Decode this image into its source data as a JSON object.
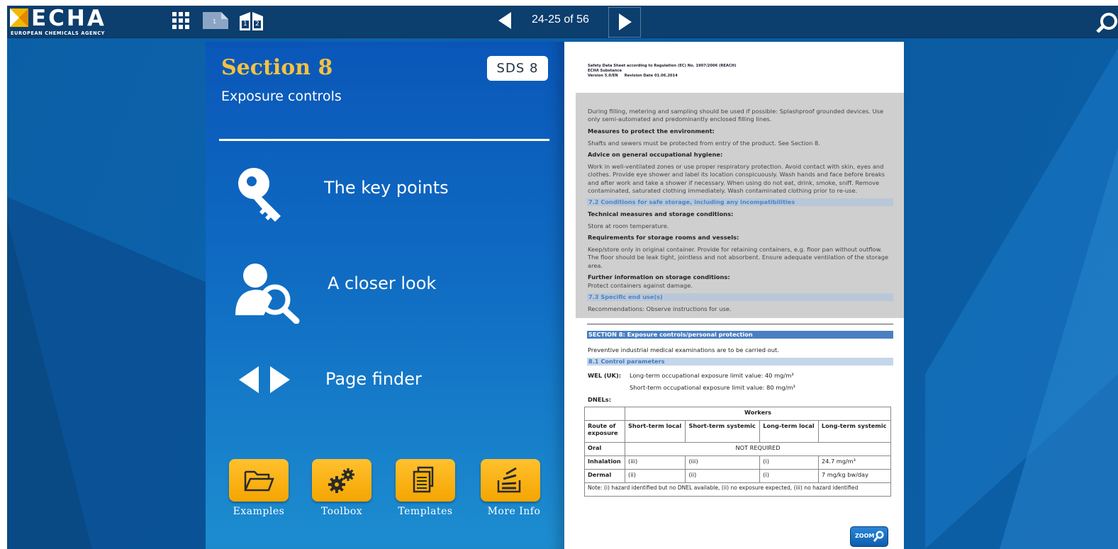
{
  "toolbar": {
    "logo_text": "ECHA",
    "logo_subtitle": "EUROPEAN CHEMICALS AGENCY",
    "page_indicator": "24-25 of 56",
    "single_page_num": "1",
    "double_page_nums": [
      "1",
      "2"
    ]
  },
  "left_page": {
    "section_title": "Section 8",
    "section_subtitle": "Exposure controls",
    "badge": "SDS 8",
    "menu": [
      {
        "label": "The key points",
        "icon": "key-icon"
      },
      {
        "label": "A closer look",
        "icon": "person-magnifier-icon"
      },
      {
        "label": "Page finder",
        "icon": "left-right-arrows-icon"
      }
    ],
    "tiles": [
      {
        "label": "Examples",
        "icon": "open-folder-icon"
      },
      {
        "label": "Toolbox",
        "icon": "gears-icon"
      },
      {
        "label": "Templates",
        "icon": "documents-icon"
      },
      {
        "label": "More Info",
        "icon": "stack-info-icon"
      }
    ]
  },
  "right_page": {
    "header": [
      "Safety Data Sheet according to Regulation (EC) No. 1907/2006 (REACH)",
      "ECHA Substance",
      "Version 5.0/EN     Revision Date 01.06.2014"
    ],
    "grey_block": [
      {
        "type": "text",
        "text": "During filling, metering and sampling should be used if possible: Splashproof grounded devices. Use only semi-automated and predominantly enclosed filling lines."
      },
      {
        "type": "bold",
        "text": "Measures to protect the environment:"
      },
      {
        "type": "text",
        "text": "Shafts and sewers must be protected from entry of the product. See Section 8."
      },
      {
        "type": "bold",
        "text": "Advice on general occupational hygiene:"
      },
      {
        "type": "text",
        "text": "Work in well-ventilated zones or use proper respiratory protection. Avoid contact with skin, eyes and clothes. Provide eye shower and label its location conspicuously. Wash hands and face before breaks and after work and take a shower if necessary. When using do not eat, drink, smoke, sniff. Remove contaminated, saturated clothing immediately. Wash contaminated clothing prior to re-use."
      },
      {
        "type": "sec",
        "text": "7.2 Conditions for safe storage, including any incompatibilities"
      },
      {
        "type": "bold",
        "text": "Technical measures and storage conditions:"
      },
      {
        "type": "text",
        "text": "Store at room temperature."
      },
      {
        "type": "bold",
        "text": "Requirements for storage rooms and vessels:"
      },
      {
        "type": "text",
        "text": "Keep/store only in original container. Provide for retaining containers, e.g. floor pan without outflow. The floor should be leak tight, jointless and not absorbent. Ensure adequate ventilation of the storage area."
      },
      {
        "type": "bold",
        "text": "Further information on storage conditions:"
      },
      {
        "type": "text",
        "text": "Protect containers against damage."
      },
      {
        "type": "sec",
        "text": "7.3 Specific end use(s)"
      },
      {
        "type": "text",
        "text": "Recommendations: Observe instructions for use."
      }
    ],
    "section8_title": "SECTION 8: Exposure controls/personal protection",
    "preventive": "Preventive industrial medical examinations are to be carried out.",
    "sub81": "8.1 Control parameters",
    "wel_label": "WEL (UK):",
    "wel_long": "Long-term occupational exposure limit value: 40 mg/m³",
    "wel_short": "Short-term occupational exposure limit value: 80 mg/m³",
    "dnels": "DNELs:",
    "table": {
      "workers": "Workers",
      "route": "Route of exposure",
      "headers": [
        "Short-term local",
        "Short-term systemic",
        "Long-term local",
        "Long-term systemic"
      ],
      "rows": [
        {
          "route": "Oral",
          "merged": "NOT REQUIRED"
        },
        {
          "route": "Inhalation",
          "cells": [
            "(iii)",
            "(iii)",
            "(i)",
            "24.7 mg/m³"
          ]
        },
        {
          "route": "Dermal",
          "cells": [
            "(ii)",
            "(ii)",
            "(i)",
            "7 mg/kg bw/day"
          ]
        }
      ],
      "note": "Note: (i) hazard identified but no DNEL available, (ii) no exposure expected, (iii) no hazard identified"
    },
    "zoom_label": "ZOOM"
  },
  "colors": {
    "toolbar_bg": "#0c3e6e",
    "section_title": "#f5c242",
    "tile_orange": "#f5a500",
    "doc_section_bar": "#4a7fc1",
    "doc_sub_bar": "#c5d6ea"
  }
}
